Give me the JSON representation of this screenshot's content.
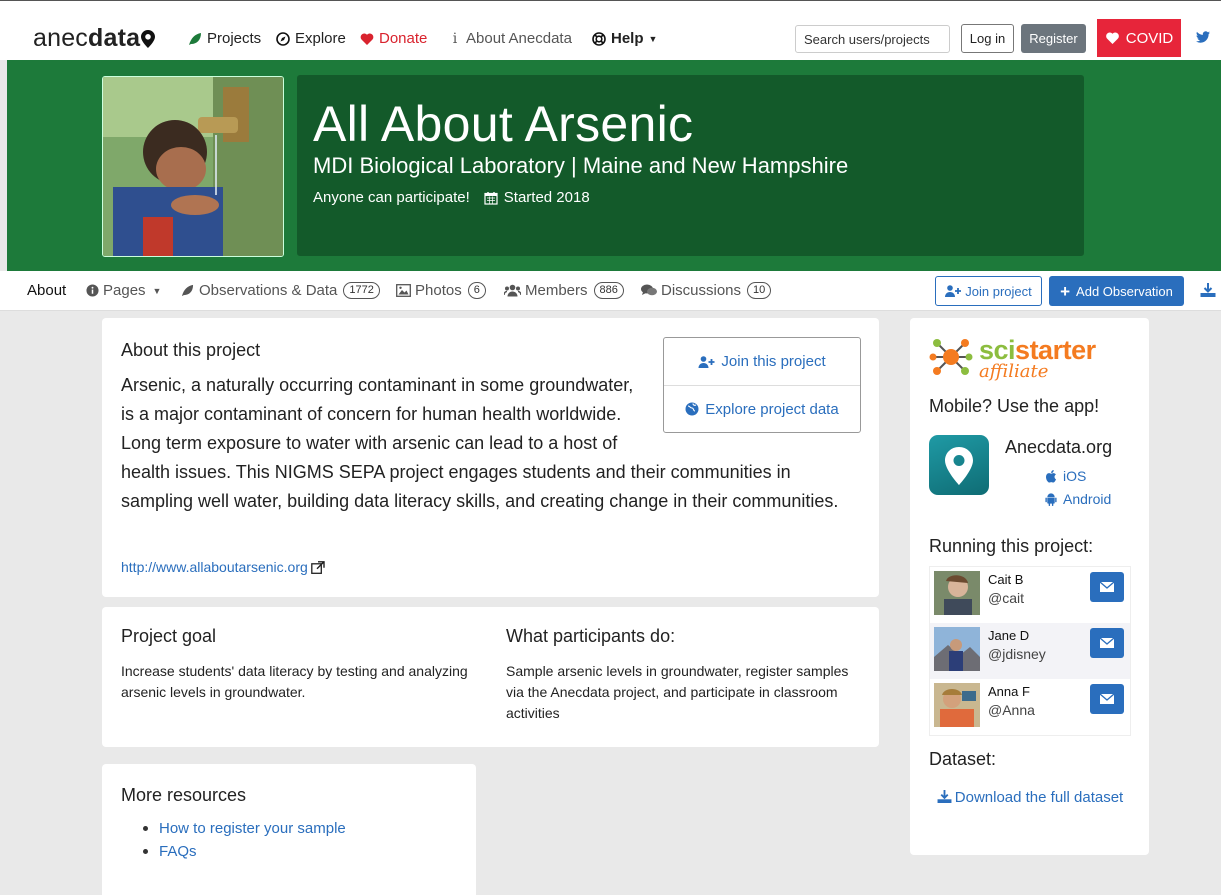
{
  "navbar": {
    "brand_plain": "anec",
    "brand_bold": "data",
    "projects": "Projects",
    "explore": "Explore",
    "donate": "Donate",
    "about": "About Anecdata",
    "help": "Help",
    "search_placeholder": "Search users/projects",
    "login": "Log in",
    "register": "Register",
    "covid": "COVID",
    "colors": {
      "donate": "#d9232e",
      "covid": "#e7253a",
      "register": "#6c757d"
    }
  },
  "hero": {
    "title": "All About Arsenic",
    "subtitle": "MDI Biological Laboratory | Maine and New Hampshire",
    "participation": "Anyone can participate!",
    "started": "Started 2018",
    "colors": {
      "background": "#1d7a3a",
      "panel": "#135a2a"
    }
  },
  "tabs": {
    "about": "About",
    "pages": "Pages",
    "observations": "Observations & Data",
    "observations_count": "1772",
    "photos": "Photos",
    "photos_count": "6",
    "members": "Members",
    "members_count": "886",
    "discussions": "Discussions",
    "discussions_count": "10",
    "join": "Join project",
    "add_observation": "Add Observation"
  },
  "about": {
    "heading": "About this project",
    "description": "Arsenic, a naturally occurring contaminant in some groundwater, is a major contaminant of concern for human health worldwide. Long term exposure to water with arsenic can lead to a host of health issues. This NIGMS SEPA project engages students and their communities in sampling well water, building data literacy skills, and creating change in their communities.",
    "link": "http://www.allaboutarsenic.org",
    "join_this": "Join this project",
    "explore_data": "Explore project data"
  },
  "goal": {
    "heading": "Project goal",
    "text": "Increase students' data literacy by testing and analyzing arsenic levels in groundwater.",
    "participants_heading": "What participants do:",
    "participants_text": "Sample arsenic levels in groundwater, register samples via the Anecdata project, and participate in classroom activities"
  },
  "resources": {
    "heading": "More resources",
    "items": [
      "How to register your sample",
      "FAQs"
    ]
  },
  "sidebar": {
    "sci_a": "sci",
    "sci_b": "starter",
    "sci_affiliate": "affiliate",
    "mobile": "Mobile? Use the app!",
    "app_name": "Anecdata.org",
    "ios": "iOS",
    "android": "Android",
    "running": "Running this project:",
    "people": [
      {
        "name": "Cait B",
        "user": "@cait"
      },
      {
        "name": "Jane D",
        "user": "@jdisney"
      },
      {
        "name": "Anna F",
        "user": "@Anna"
      }
    ],
    "dataset": "Dataset:",
    "download": "Download the full dataset"
  }
}
